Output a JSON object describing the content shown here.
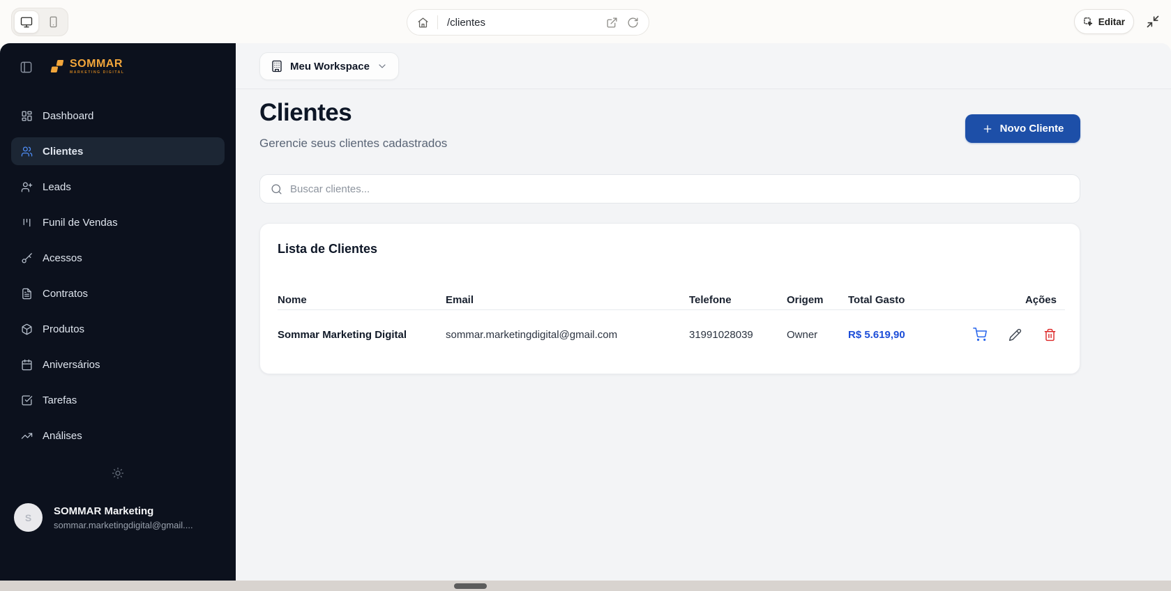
{
  "topbar": {
    "device_toggle": {
      "active": "desktop",
      "desktop_icon": "monitor",
      "mobile_icon": "smartphone"
    },
    "url_bar": {
      "path": "/clientes",
      "home_icon": "house",
      "open_icon": "external-link",
      "refresh_icon": "rotate-cw"
    },
    "edit_button": {
      "label": "Editar",
      "icon": "select-dashed-pointer"
    },
    "collapse_icon": "minimize-arrows"
  },
  "sidebar": {
    "logo": {
      "text": "SOMMAR",
      "tagline": "MARKETING DIGITAL"
    },
    "items": [
      {
        "label": "Dashboard",
        "icon": "layout-dashboard",
        "active": false
      },
      {
        "label": "Clientes",
        "icon": "users",
        "active": true
      },
      {
        "label": "Leads",
        "icon": "user-plus",
        "active": false
      },
      {
        "label": "Funil de Vendas",
        "icon": "kanban",
        "active": false
      },
      {
        "label": "Acessos",
        "icon": "key",
        "active": false
      },
      {
        "label": "Contratos",
        "icon": "file-text",
        "active": false
      },
      {
        "label": "Produtos",
        "icon": "package",
        "active": false
      },
      {
        "label": "Aniversários",
        "icon": "calendar",
        "active": false
      },
      {
        "label": "Tarefas",
        "icon": "square-check",
        "active": false
      },
      {
        "label": "Análises",
        "icon": "trending-up",
        "active": false
      }
    ],
    "theme_toggle_icon": "sun",
    "user": {
      "avatar_initial": "S",
      "name": "SOMMAR Marketing",
      "email": "sommar.marketingdigital@gmail...."
    }
  },
  "workspace": {
    "label": "Meu Workspace",
    "icon": "building",
    "chevron_icon": "chevron-down"
  },
  "main": {
    "title": "Clientes",
    "subtitle": "Gerencie seus clientes cadastrados",
    "new_client_button": {
      "label": "Novo Cliente",
      "icon": "plus"
    },
    "search": {
      "placeholder": "Buscar clientes...",
      "icon": "search"
    },
    "card": {
      "title": "Lista de Clientes",
      "columns": [
        "Nome",
        "Email",
        "Telefone",
        "Origem",
        "Total Gasto",
        "Ações"
      ],
      "rows": [
        {
          "nome": "Sommar Marketing Digital",
          "email": "sommar.marketingdigital@gmail.com",
          "telefone": "31991028039",
          "origem": "Owner",
          "total_gasto": "R$ 5.619,90",
          "action_icons": [
            "shopping-cart",
            "pencil",
            "trash"
          ]
        }
      ]
    }
  },
  "colors": {
    "sidebar_bg": "#0c111d",
    "logo_orange": "#f2a63b",
    "active_item_blue": "#4f8ef7",
    "primary_button_blue": "#1d4fa8",
    "amount_blue": "#1d4ed8",
    "cart_blue": "#2563eb",
    "danger_red": "#dc2626"
  }
}
